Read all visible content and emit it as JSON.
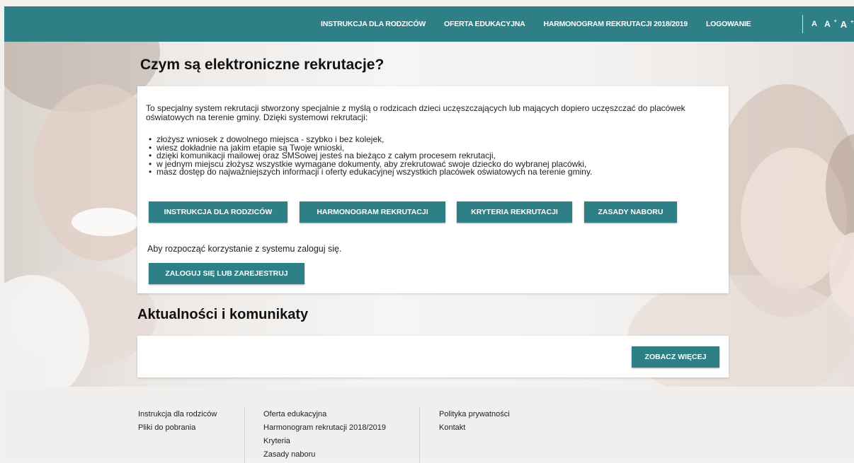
{
  "nav": {
    "items": [
      "INSTRUKCJA DLA RODZICÓW",
      "OFERTA EDUKACYJNA",
      "HARMONOGRAM REKRUTACJI 2018/2019",
      "LOGOWANIE"
    ]
  },
  "font_sizes": [
    "A",
    "A",
    "A"
  ],
  "font_sups": [
    "+",
    "++"
  ],
  "hero": {
    "title": "Czym są elektroniczne rekrutacje?",
    "intro": "To specjalny system rekrutacji stworzony specjalnie z myślą o rodzicach dzieci uczęszczających lub mających dopiero uczęszczać do placówek oświatowych na terenie gminy. Dzięki systemowi rekrutacji:",
    "benefits": [
      "złożysz wniosek z dowolnego miejsca - szybko i bez kolejek,",
      "wiesz dokładnie na jakim etapie są Twoje wnioski,",
      "dzięki komunikacji mailowej oraz SMSowej jesteś na bieżąco z całym procesem rekrutacji,",
      "w jednym miejscu złożysz wszystkie wymagane dokumenty, aby zrekrutować swoje dziecko do wybranej placówki,",
      "masz dostęp do najważniejszych informacji i oferty edukacyjnej wszystkich placówek oświatowych na terenie gminy."
    ],
    "buttons": [
      "INSTRUKCJA DLA RODZICÓW",
      "HARMONOGRAM REKRUTACJI",
      "KRYTERIA REKRUTACJI",
      "ZASADY NABORU"
    ],
    "login_text": "Aby rozpocząć korzystanie z systemu zaloguj się.",
    "login_button": "ZALOGUJ SIĘ LUB ZAREJESTRUJ"
  },
  "news": {
    "title": "Aktualności i komunikaty",
    "more_button": "ZOBACZ WIĘCEJ"
  },
  "footer": {
    "col1": [
      "Instrukcja dla rodziców",
      "Pliki do pobrania"
    ],
    "col2": [
      "Oferta edukacyjna",
      "Harmonogram rekrutacji 2018/2019",
      "Kryteria",
      "Zasady naboru"
    ],
    "col3": [
      "Polityka prywatności",
      "Kontakt"
    ]
  },
  "colors": {
    "accent": "#2f7f86"
  }
}
